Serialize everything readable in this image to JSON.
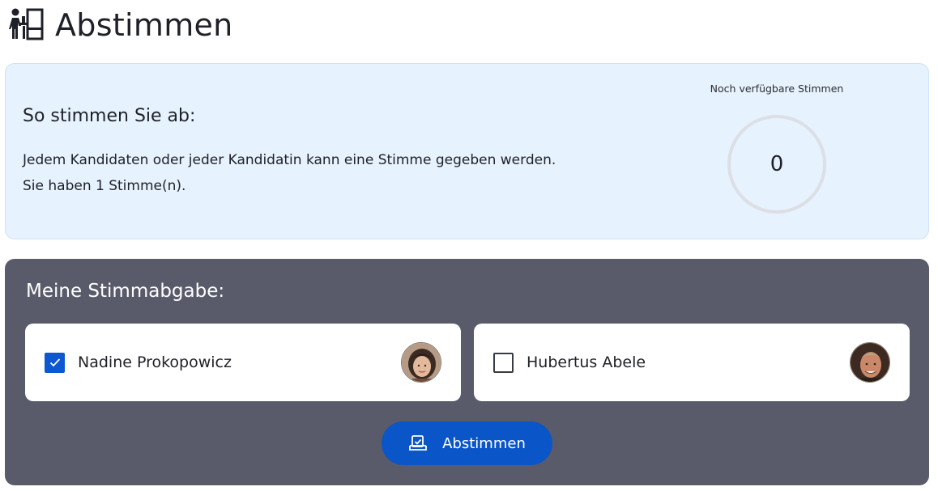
{
  "header": {
    "title": "Abstimmen",
    "icon": "voting-person-icon"
  },
  "info": {
    "heading": "So stimmen Sie ab:",
    "line1": "Jedem Kandidaten oder jeder Kandidatin kann eine Stimme gegeben werden.",
    "line2": "Sie haben 1 Stimme(n).",
    "remaining_label": "Noch verfügbare Stimmen",
    "remaining_value": "0"
  },
  "vote": {
    "heading": "Meine Stimmabgabe:",
    "candidates": [
      {
        "name": "Nadine Prokopowicz",
        "checked": true,
        "avatar": "female-portrait"
      },
      {
        "name": "Hubertus Abele",
        "checked": false,
        "avatar": "male-portrait"
      }
    ],
    "button_label": "Abstimmen",
    "button_icon": "ballot-box-icon"
  },
  "colors": {
    "info_bg": "#e6f2fd",
    "panel_bg": "#595b6a",
    "accent": "#0a55c8",
    "ring": "#dcdfe4"
  }
}
